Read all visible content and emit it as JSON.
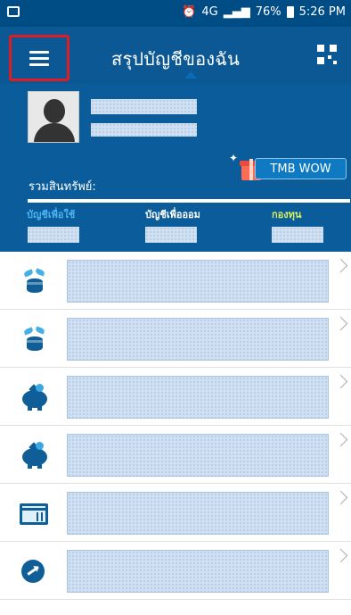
{
  "status_bar": {
    "network": "4G",
    "battery": "76%",
    "time": "5:26 PM"
  },
  "header": {
    "title": "สรุปบัญชีของฉัน"
  },
  "summary": {
    "assets_label": "รวมสินทรัพย์:",
    "wow_label": "TMB WOW",
    "tabs": [
      "บัญชีเพื่อใช้",
      "บัญชีเพื่อออม",
      "กองทุน"
    ],
    "progress": 1.0
  },
  "icons": {
    "menu": "hamburger-menu-icon",
    "qr": "qr-code-icon",
    "avatar": "user-avatar-icon",
    "gift": "gift-icon",
    "rows": [
      "coin-stack-icon",
      "coin-stack-icon",
      "piggy-bank-icon",
      "piggy-bank-icon",
      "credit-card-icon",
      "fund-growth-icon"
    ]
  },
  "colors": {
    "header": "#0b5894",
    "accent_red": "#e01b22",
    "tab_active": "#4cb3f0",
    "tab_fund": "#d9f25f"
  }
}
